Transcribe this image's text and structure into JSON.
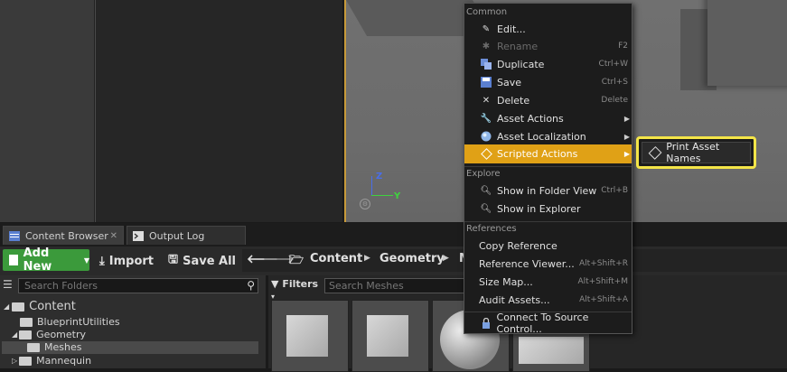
{
  "tabs": [
    {
      "label": "Content Browser",
      "icon": "content-browser-icon"
    },
    {
      "label": "Output Log",
      "icon": "output-log-icon"
    }
  ],
  "viewport": {
    "axis_z": "Z",
    "axis_y": "Y"
  },
  "toolbar": {
    "add_new": "Add New",
    "import": "Import",
    "save_all": "Save All",
    "breadcrumbs": [
      "Content",
      "Geometry",
      "M"
    ]
  },
  "folders": {
    "search_placeholder": "Search Folders",
    "tree": [
      {
        "label": "Content",
        "level": 0,
        "expanded": true
      },
      {
        "label": "BlueprintUtilities",
        "level": 1
      },
      {
        "label": "Geometry",
        "level": 1,
        "expanded": true
      },
      {
        "label": "Meshes",
        "level": 2,
        "selected": true
      },
      {
        "label": "Mannequin",
        "level": 1,
        "expanded": false
      }
    ]
  },
  "assets": {
    "filters_label": "Filters",
    "search_placeholder": "Search Meshes"
  },
  "context_menu": {
    "sections": [
      {
        "title": "Common",
        "items": [
          {
            "label": "Edit...",
            "shortcut": "",
            "icon": "pencil-icon"
          },
          {
            "label": "Rename",
            "shortcut": "F2",
            "icon": "rename-icon",
            "disabled": true
          },
          {
            "label": "Duplicate",
            "shortcut": "Ctrl+W",
            "icon": "duplicate-icon"
          },
          {
            "label": "Save",
            "shortcut": "Ctrl+S",
            "icon": "save-icon"
          },
          {
            "label": "Delete",
            "shortcut": "Delete",
            "icon": "delete-icon"
          },
          {
            "label": "Asset Actions",
            "shortcut": "",
            "icon": "wrench-icon",
            "submenu": true
          },
          {
            "label": "Asset Localization",
            "shortcut": "",
            "icon": "globe-icon",
            "submenu": true
          },
          {
            "label": "Scripted Actions",
            "shortcut": "",
            "icon": "diamond-icon",
            "submenu": true,
            "highlighted": true
          }
        ]
      },
      {
        "title": "Explore",
        "items": [
          {
            "label": "Show in Folder View",
            "shortcut": "Ctrl+B",
            "icon": "search-icon"
          },
          {
            "label": "Show in Explorer",
            "shortcut": "",
            "icon": "search-icon"
          }
        ]
      },
      {
        "title": "References",
        "items": [
          {
            "label": "Copy Reference",
            "shortcut": ""
          },
          {
            "label": "Reference Viewer...",
            "shortcut": "Alt+Shift+R"
          },
          {
            "label": "Size Map...",
            "shortcut": "Alt+Shift+M"
          },
          {
            "label": "Audit Assets...",
            "shortcut": "Alt+Shift+A"
          }
        ]
      }
    ],
    "footer_item": {
      "label": "Connect To Source Control...",
      "icon": "source-control-icon"
    }
  },
  "submenu": {
    "label": "Print Asset Names",
    "icon": "diamond-icon"
  },
  "colors": {
    "highlight": "#e0a116",
    "add_new": "#3b9a3b",
    "callout": "#f4e548"
  }
}
